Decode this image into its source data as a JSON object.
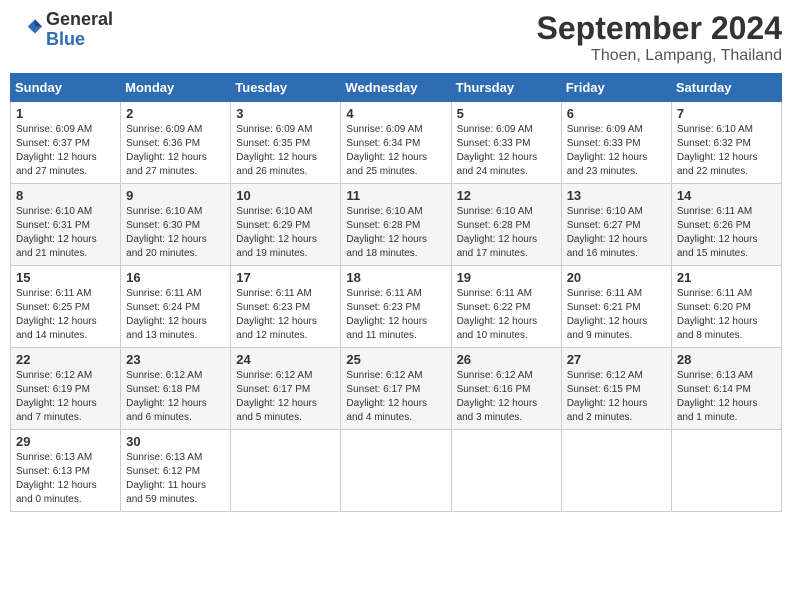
{
  "header": {
    "logo_general": "General",
    "logo_blue": "Blue",
    "month_year": "September 2024",
    "location": "Thoen, Lampang, Thailand"
  },
  "weekdays": [
    "Sunday",
    "Monday",
    "Tuesday",
    "Wednesday",
    "Thursday",
    "Friday",
    "Saturday"
  ],
  "weeks": [
    [
      {
        "day": "1",
        "sunrise": "6:09 AM",
        "sunset": "6:37 PM",
        "daylight": "12 hours and 27 minutes."
      },
      {
        "day": "2",
        "sunrise": "6:09 AM",
        "sunset": "6:36 PM",
        "daylight": "12 hours and 27 minutes."
      },
      {
        "day": "3",
        "sunrise": "6:09 AM",
        "sunset": "6:35 PM",
        "daylight": "12 hours and 26 minutes."
      },
      {
        "day": "4",
        "sunrise": "6:09 AM",
        "sunset": "6:34 PM",
        "daylight": "12 hours and 25 minutes."
      },
      {
        "day": "5",
        "sunrise": "6:09 AM",
        "sunset": "6:33 PM",
        "daylight": "12 hours and 24 minutes."
      },
      {
        "day": "6",
        "sunrise": "6:09 AM",
        "sunset": "6:33 PM",
        "daylight": "12 hours and 23 minutes."
      },
      {
        "day": "7",
        "sunrise": "6:10 AM",
        "sunset": "6:32 PM",
        "daylight": "12 hours and 22 minutes."
      }
    ],
    [
      {
        "day": "8",
        "sunrise": "6:10 AM",
        "sunset": "6:31 PM",
        "daylight": "12 hours and 21 minutes."
      },
      {
        "day": "9",
        "sunrise": "6:10 AM",
        "sunset": "6:30 PM",
        "daylight": "12 hours and 20 minutes."
      },
      {
        "day": "10",
        "sunrise": "6:10 AM",
        "sunset": "6:29 PM",
        "daylight": "12 hours and 19 minutes."
      },
      {
        "day": "11",
        "sunrise": "6:10 AM",
        "sunset": "6:28 PM",
        "daylight": "12 hours and 18 minutes."
      },
      {
        "day": "12",
        "sunrise": "6:10 AM",
        "sunset": "6:28 PM",
        "daylight": "12 hours and 17 minutes."
      },
      {
        "day": "13",
        "sunrise": "6:10 AM",
        "sunset": "6:27 PM",
        "daylight": "12 hours and 16 minutes."
      },
      {
        "day": "14",
        "sunrise": "6:11 AM",
        "sunset": "6:26 PM",
        "daylight": "12 hours and 15 minutes."
      }
    ],
    [
      {
        "day": "15",
        "sunrise": "6:11 AM",
        "sunset": "6:25 PM",
        "daylight": "12 hours and 14 minutes."
      },
      {
        "day": "16",
        "sunrise": "6:11 AM",
        "sunset": "6:24 PM",
        "daylight": "12 hours and 13 minutes."
      },
      {
        "day": "17",
        "sunrise": "6:11 AM",
        "sunset": "6:23 PM",
        "daylight": "12 hours and 12 minutes."
      },
      {
        "day": "18",
        "sunrise": "6:11 AM",
        "sunset": "6:23 PM",
        "daylight": "12 hours and 11 minutes."
      },
      {
        "day": "19",
        "sunrise": "6:11 AM",
        "sunset": "6:22 PM",
        "daylight": "12 hours and 10 minutes."
      },
      {
        "day": "20",
        "sunrise": "6:11 AM",
        "sunset": "6:21 PM",
        "daylight": "12 hours and 9 minutes."
      },
      {
        "day": "21",
        "sunrise": "6:11 AM",
        "sunset": "6:20 PM",
        "daylight": "12 hours and 8 minutes."
      }
    ],
    [
      {
        "day": "22",
        "sunrise": "6:12 AM",
        "sunset": "6:19 PM",
        "daylight": "12 hours and 7 minutes."
      },
      {
        "day": "23",
        "sunrise": "6:12 AM",
        "sunset": "6:18 PM",
        "daylight": "12 hours and 6 minutes."
      },
      {
        "day": "24",
        "sunrise": "6:12 AM",
        "sunset": "6:17 PM",
        "daylight": "12 hours and 5 minutes."
      },
      {
        "day": "25",
        "sunrise": "6:12 AM",
        "sunset": "6:17 PM",
        "daylight": "12 hours and 4 minutes."
      },
      {
        "day": "26",
        "sunrise": "6:12 AM",
        "sunset": "6:16 PM",
        "daylight": "12 hours and 3 minutes."
      },
      {
        "day": "27",
        "sunrise": "6:12 AM",
        "sunset": "6:15 PM",
        "daylight": "12 hours and 2 minutes."
      },
      {
        "day": "28",
        "sunrise": "6:13 AM",
        "sunset": "6:14 PM",
        "daylight": "12 hours and 1 minute."
      }
    ],
    [
      {
        "day": "29",
        "sunrise": "6:13 AM",
        "sunset": "6:13 PM",
        "daylight": "12 hours and 0 minutes."
      },
      {
        "day": "30",
        "sunrise": "6:13 AM",
        "sunset": "6:12 PM",
        "daylight": "11 hours and 59 minutes."
      },
      null,
      null,
      null,
      null,
      null
    ]
  ]
}
